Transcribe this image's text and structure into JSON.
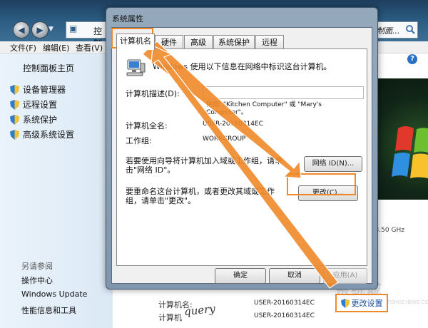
{
  "control_panel": {
    "address_text": "控制",
    "search_text": "搜制面...",
    "menu": [
      "文件(F)",
      "编辑(E)",
      "查看(V)"
    ],
    "left_pane": {
      "home": "控制面板主页",
      "tasks": [
        "设备管理器",
        "远程设置",
        "系统保护",
        "高级系统设置"
      ],
      "see_also_title": "另请参阅",
      "see_also": [
        "操作中心",
        "Windows Update",
        "性能信息和工具"
      ]
    },
    "processor_speed": "z 3.50 GHz",
    "computer_name_label": "计算机名:",
    "computer_full_name_label": "计算机",
    "computer_name_value": "USER-20160314EC",
    "computer_full_name_value": "USER-20160314EC",
    "signature_text": "query",
    "change_settings_label": "更改设置",
    "watermark": "系统城",
    "watermark_sub": "XITONGCHENG.COM"
  },
  "dialog": {
    "title": "系统属性",
    "tabs": [
      "计算机名",
      "硬件",
      "高级",
      "系统保护",
      "远程"
    ],
    "active_tab": "计算机名",
    "intro": "Windows 使用以下信息在网络中标识这台计算机。",
    "description_label": "计算机描述(D):",
    "description_value": "",
    "example": "例如: \"Kitchen Computer\" 或 \"Mary's Computer\"。",
    "full_name_label": "计算机全名:",
    "full_name_value": "USER-20160314EC",
    "workgroup_label": "工作组:",
    "workgroup_value": "WORKGROUP",
    "network_id_text": "若要使用向导将计算机加入域或工作组，请单击\"网络 ID\"。",
    "network_id_button": "网络 ID(N)...",
    "rename_text": "要重命名这台计算机，或者更改其域或工作组，请单击\"更改\"。",
    "change_button": "更改(C)...",
    "ok_button": "确定",
    "cancel_button": "取消",
    "apply_button": "应用(A)"
  },
  "colors": {
    "highlight": "#f0892a",
    "titlebar": "#2a5a7f",
    "link": "#1a4fa0"
  }
}
